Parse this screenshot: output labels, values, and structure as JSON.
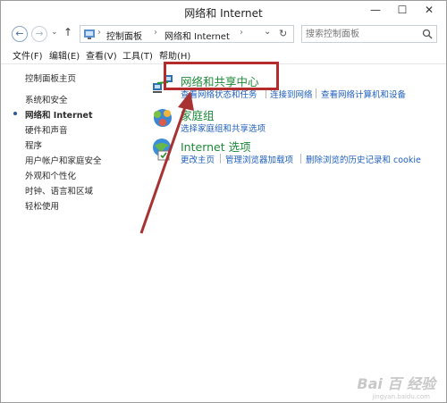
{
  "window": {
    "title": "网络和 Internet"
  },
  "window_controls": {
    "minimize": "—",
    "maximize": "☐",
    "close": "✕"
  },
  "nav": {
    "back": "←",
    "forward": "→",
    "up": "↑"
  },
  "address": {
    "segments": [
      "控制面板",
      "网络和 Internet"
    ],
    "separator": "›",
    "dropdown": "⌄",
    "refresh": "↻"
  },
  "search": {
    "placeholder": "搜索控制面板"
  },
  "menu": [
    {
      "label": "文件(F)"
    },
    {
      "label": "编辑(E)"
    },
    {
      "label": "查看(V)"
    },
    {
      "label": "工具(T)"
    },
    {
      "label": "帮助(H)"
    }
  ],
  "sidebar": {
    "items": [
      {
        "label": "控制面板主页"
      },
      {
        "label": "系统和安全"
      },
      {
        "label": "网络和 Internet",
        "active": true
      },
      {
        "label": "硬件和声音"
      },
      {
        "label": "程序"
      },
      {
        "label": "用户帐户和家庭安全"
      },
      {
        "label": "外观和个性化"
      },
      {
        "label": "时钟、语言和区域"
      },
      {
        "label": "轻松使用"
      }
    ]
  },
  "categories": [
    {
      "title": "网络和共享中心",
      "icon": "network-sharing-icon",
      "links": [
        "查看网络状态和任务",
        "连接到网络",
        "查看网络计算机和设备"
      ]
    },
    {
      "title": "家庭组",
      "icon": "homegroup-icon",
      "links": [
        "选择家庭组和共享选项"
      ]
    },
    {
      "title": "Internet 选项",
      "icon": "internet-options-icon",
      "links": [
        "更改主页",
        "管理浏览器加载项",
        "删除浏览的历史记录和 cookie"
      ]
    }
  ],
  "watermark": {
    "text": "Bai 百 经验",
    "sub": "jingyan.baidu.com"
  },
  "colors": {
    "accent": "#1e8a3a",
    "link": "#1f5fbf",
    "annotation": "#b52a2a"
  }
}
